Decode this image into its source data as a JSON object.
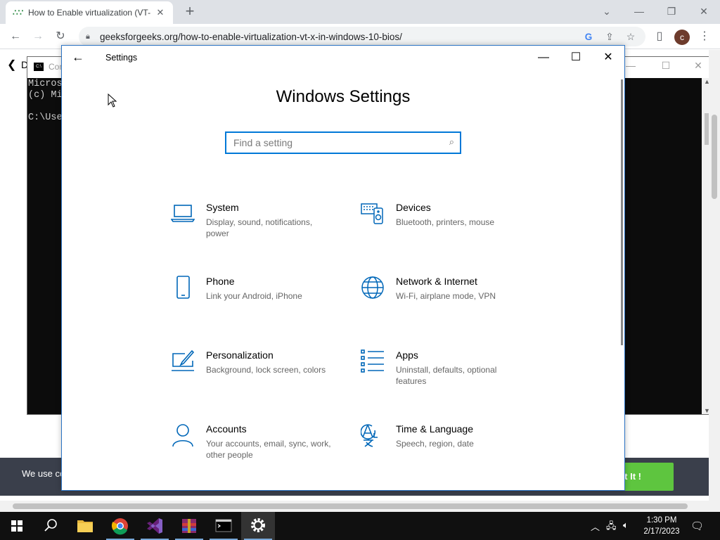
{
  "browser": {
    "tab_title": "How to Enable virtualization (VT-",
    "tab_favicon": "gfg-icon",
    "url": "geeksforgeeks.org/how-to-enable-virtualization-vt-x-in-windows-10-bios/",
    "profile_initial": "c"
  },
  "gfg_page": {
    "back_glyph": "❮",
    "partial_heading": "D",
    "cookie_text": "We use co",
    "cookie_button": "t It !"
  },
  "cmd": {
    "title": "Com",
    "lines": [
      "Micros",
      "(c) Mi",
      "",
      "C:\\Use"
    ]
  },
  "settings": {
    "window_title": "Settings",
    "heading": "Windows Settings",
    "search_placeholder": "Find a setting",
    "categories": [
      {
        "name": "System",
        "desc": "Display, sound, notifications, power",
        "icon": "laptop-icon"
      },
      {
        "name": "Devices",
        "desc": "Bluetooth, printers, mouse",
        "icon": "devices-icon"
      },
      {
        "name": "Phone",
        "desc": "Link your Android, iPhone",
        "icon": "phone-icon"
      },
      {
        "name": "Network & Internet",
        "desc": "Wi-Fi, airplane mode, VPN",
        "icon": "globe-icon"
      },
      {
        "name": "Personalization",
        "desc": "Background, lock screen, colors",
        "icon": "personalization-icon"
      },
      {
        "name": "Apps",
        "desc": "Uninstall, defaults, optional features",
        "icon": "apps-list-icon"
      },
      {
        "name": "Accounts",
        "desc": "Your accounts, email, sync, work, other people",
        "icon": "person-icon"
      },
      {
        "name": "Time & Language",
        "desc": "Speech, region, date",
        "icon": "time-language-icon"
      }
    ]
  },
  "taskbar": {
    "time": "1:30 PM",
    "date": "2/17/2023",
    "apps": [
      "file-explorer-icon",
      "chrome-icon",
      "visual-studio-icon",
      "winrar-icon",
      "terminal-icon",
      "settings-gear-icon"
    ]
  },
  "colors": {
    "accent": "#0078d7",
    "icon_blue": "#0067b8",
    "cookie_bg": "#3a3f4b",
    "cookie_btn": "#5ec53f"
  }
}
